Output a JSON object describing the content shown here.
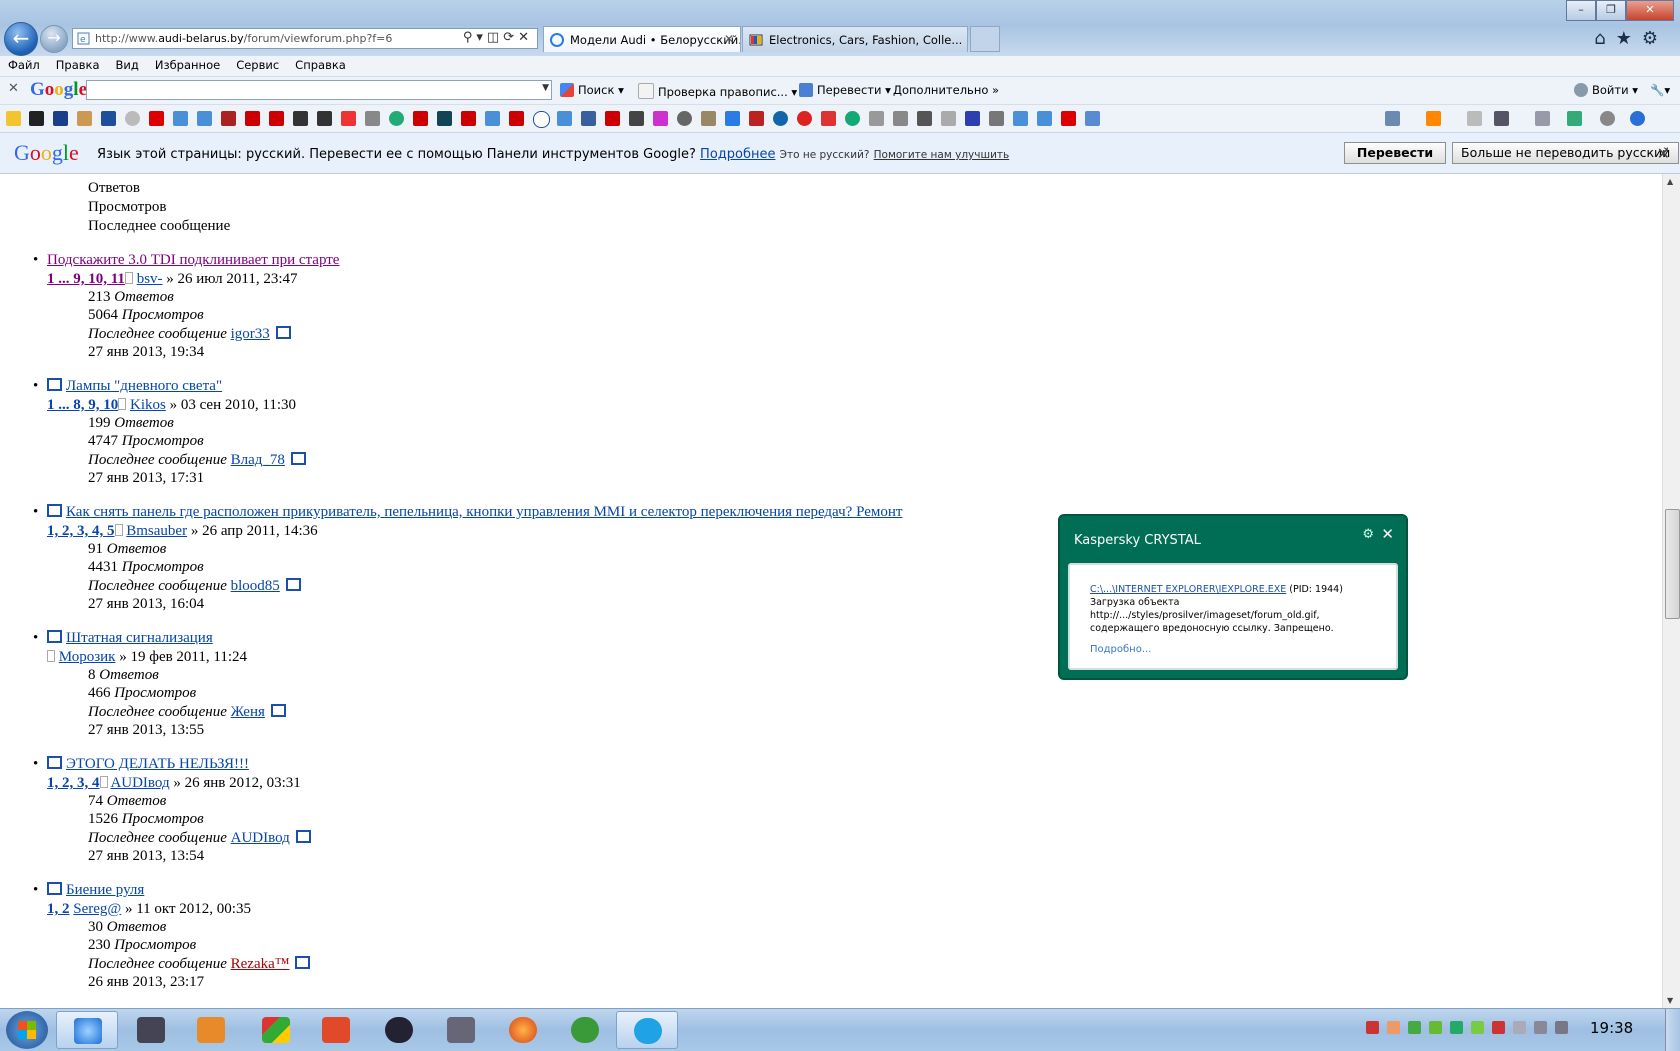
{
  "browser": {
    "url_prefix": "http://www.",
    "url_domain": "audi-belarus.by",
    "url_path": "/forum/viewforum.php?f=6",
    "tabs": [
      {
        "title": "Модели Audi • Белорусский...",
        "active": true
      },
      {
        "title": "Electronics, Cars, Fashion, Colle...",
        "active": false
      }
    ]
  },
  "menu": [
    "Файл",
    "Правка",
    "Вид",
    "Избранное",
    "Сервис",
    "Справка"
  ],
  "google_toolbar": {
    "logo": "Google",
    "search": "Поиск",
    "spell": "Проверка правопис...",
    "translate": "Перевести",
    "more": "Дополнительно",
    "signin": "Войти"
  },
  "translate_bar": {
    "logo": "Google",
    "message": "Язык этой страницы: русский. Перевести ее с помощью Панели инструментов Google?",
    "details_link": "Подробнее",
    "not_russian": "Это не русский?",
    "help_link": "Помогите нам улучшить",
    "translate_btn": "Перевести",
    "never_btn": "Больше не переводить русский"
  },
  "forum": {
    "header_lines": [
      "Ответов",
      "Просмотров",
      "Последнее сообщение"
    ],
    "labels": {
      "replies": "Ответов",
      "views": "Просмотров",
      "last": "Последнее сообщение"
    },
    "topics": [
      {
        "title": "Подскажите 3.0 TDI подклинивает при старте",
        "pages": "1 ... 9, 10, 11",
        "author": "bsv-",
        "date": "» 26 июл 2011, 23:47",
        "replies": "213",
        "views": "5064",
        "last_user": "igor33",
        "last_date": "27 янв 2013, 19:34"
      },
      {
        "title": "Лампы \"дневного света\"",
        "pages": "1 ... 8, 9, 10",
        "author": "Kikos",
        "date": "» 03 сен 2010, 11:30",
        "replies": "199",
        "views": "4747",
        "last_user": "Влад_78",
        "last_date": "27 янв 2013, 17:31"
      },
      {
        "title": "Как снять панель где расположен прикуриватель, пепельница, кнопки управления MMI и селектор переключения передач? Ремонт",
        "pages": "1, 2, 3, 4, 5",
        "author": "Bmsauber",
        "date": "» 26 апр 2011, 14:36",
        "replies": "91",
        "views": "4431",
        "last_user": "blood85",
        "last_date": "27 янв 2013, 16:04"
      },
      {
        "title": "Штатная сигнализация",
        "pages": "",
        "author": "Морозик",
        "date": "» 19 фев 2011, 11:24",
        "replies": "8",
        "views": "466",
        "last_user": "Женя",
        "last_date": "27 янв 2013, 13:55"
      },
      {
        "title": "ЭТОГО ДЕЛАТЬ НЕЛЬЗЯ!!!",
        "pages": "1, 2, 3, 4",
        "author": "AUDIвод",
        "date": "» 26 янв 2012, 03:31",
        "replies": "74",
        "views": "1526",
        "last_user": "AUDIвод",
        "last_date": "27 янв 2013, 13:54"
      },
      {
        "title": "Биение руля",
        "pages": "1, 2",
        "author": "Sereg@",
        "date": "» 11 окт 2012, 00:35",
        "replies": "30",
        "views": "230",
        "last_user": "Rezaka™",
        "last_date": "26 янв 2013, 23:17"
      }
    ]
  },
  "kaspersky": {
    "title": "Kaspersky CRYSTAL",
    "path_link": "C:\\...\\INTERNET EXPLORER\\IEXPLORE.EXE",
    "pid": " (PID: 1944)",
    "line1": "Загрузка объекта",
    "line2": "http://.../styles/prosilver/imageset/forum_old.gif,",
    "line3": "содержащего вредоносную ссылку. Запрещено.",
    "more": "Подробно..."
  },
  "taskbar": {
    "clock": "19:38"
  }
}
